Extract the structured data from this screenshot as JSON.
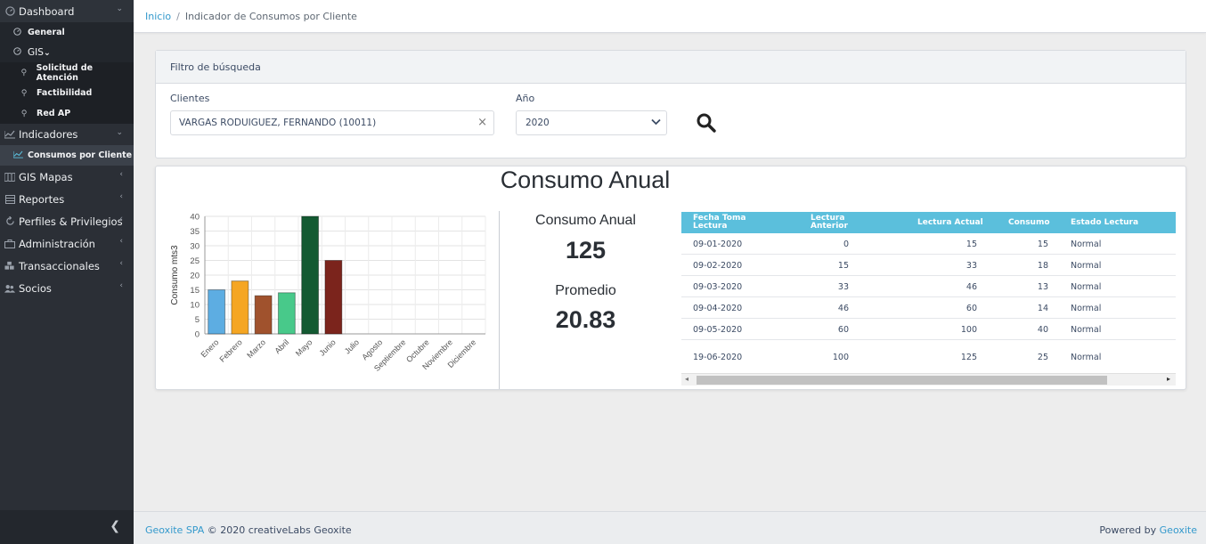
{
  "sidebar": {
    "items": [
      {
        "label": "Dashboard",
        "icon": "gauge-icon"
      },
      {
        "label": "General",
        "icon": "gauge-icon"
      },
      {
        "label": "GIS",
        "icon": "gauge-icon"
      },
      {
        "label": "Solicitud de Atención",
        "icon": "map-pin-icon"
      },
      {
        "label": "Factibilidad",
        "icon": "map-pin-icon"
      },
      {
        "label": "Red AP",
        "icon": "map-pin-icon"
      },
      {
        "label": "Indicadores",
        "icon": "line-chart-icon"
      },
      {
        "label": "Consumos por Cliente",
        "icon": "line-chart-icon"
      },
      {
        "label": "GIS Mapas",
        "icon": "map-icon"
      },
      {
        "label": "Reportes",
        "icon": "list-icon"
      },
      {
        "label": "Perfiles & Privilegios",
        "icon": "refresh-icon"
      },
      {
        "label": "Administración",
        "icon": "briefcase-icon"
      },
      {
        "label": "Transaccionales",
        "icon": "cubes-icon"
      },
      {
        "label": "Socios",
        "icon": "users-icon"
      }
    ]
  },
  "breadcrumb": {
    "home": "Inicio",
    "sep": "/",
    "current": "Indicador de Consumos por Cliente"
  },
  "filter": {
    "title": "Filtro de búsqueda",
    "clients_label": "Clientes",
    "client_value": "VARGAS RODUIGUEZ, FERNANDO (10011)",
    "year_label": "Año",
    "year_value": "2020"
  },
  "main": {
    "title": "Consumo Anual",
    "annual_label": "Consumo Anual",
    "annual_value": "125",
    "avg_label": "Promedio",
    "avg_value": "20.83"
  },
  "chart_data": {
    "type": "bar",
    "categories": [
      "Enero",
      "Febrero",
      "Marzo",
      "Abril",
      "Mayo",
      "Junio",
      "Julio",
      "Agosto",
      "Septiembre",
      "Octubre",
      "Noviembre",
      "Diciembre"
    ],
    "values": [
      15,
      18,
      13,
      14,
      40,
      25,
      0,
      0,
      0,
      0,
      0,
      0
    ],
    "colors": [
      "#5dade2",
      "#f5a623",
      "#a0522d",
      "#48c98a",
      "#145a32",
      "#7b241c"
    ],
    "ylabel": "Consumo mts3",
    "yticks": [
      0,
      5,
      10,
      15,
      20,
      25,
      30,
      35,
      40
    ],
    "ylim": [
      0,
      40
    ],
    "grid": true
  },
  "table": {
    "headers": [
      "Fecha Toma Lectura",
      "Lectura Anterior",
      "Lectura Actual",
      "Consumo",
      "Estado Lectura"
    ],
    "rows": [
      [
        "09-01-2020",
        "0",
        "15",
        "15",
        "Normal"
      ],
      [
        "09-02-2020",
        "15",
        "33",
        "18",
        "Normal"
      ],
      [
        "09-03-2020",
        "33",
        "46",
        "13",
        "Normal"
      ],
      [
        "09-04-2020",
        "46",
        "60",
        "14",
        "Normal"
      ],
      [
        "09-05-2020",
        "60",
        "100",
        "40",
        "Normal"
      ],
      [
        "19-06-2020",
        "100",
        "125",
        "25",
        "Normal"
      ]
    ]
  },
  "footer": {
    "company": "Geoxite SPA",
    "copy": "© 2020 creativeLabs Geoxite",
    "powered": "Powered by",
    "powered_link": "Geoxite"
  }
}
